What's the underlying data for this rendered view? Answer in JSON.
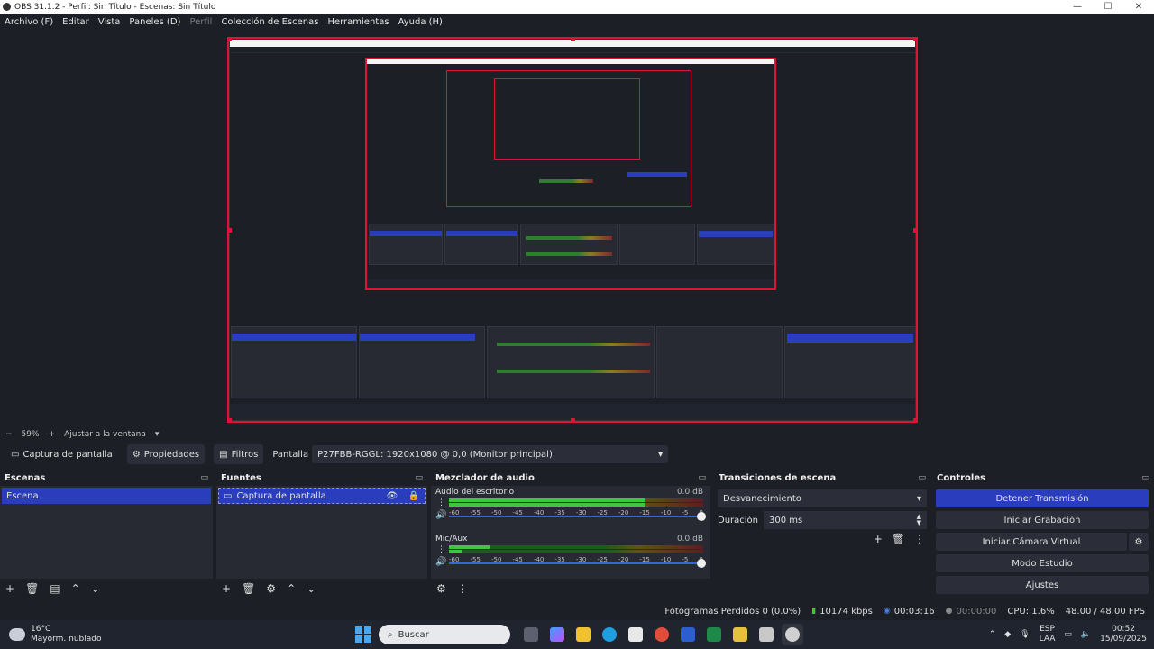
{
  "window": {
    "title": "OBS 31.1.2 - Perfil: Sin Título - Escenas: Sin Título",
    "minimize": "—",
    "maximize": "☐",
    "close": "✕"
  },
  "menu": [
    {
      "label": "Archivo (F)",
      "enabled": true
    },
    {
      "label": "Editar",
      "enabled": true
    },
    {
      "label": "Vista",
      "enabled": true
    },
    {
      "label": "Paneles (D)",
      "enabled": true
    },
    {
      "label": "Perfil",
      "enabled": false
    },
    {
      "label": "Colección de Escenas",
      "enabled": true
    },
    {
      "label": "Herramientas",
      "enabled": true
    },
    {
      "label": "Ayuda (H)",
      "enabled": true
    }
  ],
  "zoom": {
    "minus": "−",
    "value": "59%",
    "plus": "+",
    "fit_label": "Ajustar a la ventana",
    "dropdown": "▾"
  },
  "source_toolbar": {
    "source_name": "Captura de pantalla",
    "properties": "Propiedades",
    "filters": "Filtros",
    "display_label": "Pantalla",
    "display_value": "P27FBB-RGGL: 1920x1080 @ 0,0 (Monitor principal)"
  },
  "scenes": {
    "title": "Escenas",
    "items": [
      "Escena"
    ],
    "selected": 0
  },
  "sources": {
    "title": "Fuentes",
    "items": [
      "Captura de pantalla"
    ]
  },
  "mixer": {
    "title": "Mezclador de audio",
    "channels": [
      {
        "name": "Audio del escritorio",
        "db": "0.0 dB",
        "level": 0.77,
        "level2": 0.77,
        "volume": 1.0
      },
      {
        "name": "Mic/Aux",
        "db": "0.0 dB",
        "level": 0.16,
        "level2": 0.05,
        "volume": 1.0
      }
    ],
    "ticks": [
      "-60",
      "-55",
      "-50",
      "-45",
      "-40",
      "-35",
      "-30",
      "-25",
      "-20",
      "-15",
      "-10",
      "-5",
      "0"
    ]
  },
  "transitions": {
    "title": "Transiciones de escena",
    "selected": "Desvanecimiento",
    "duration_label": "Duración",
    "duration_value": "300 ms"
  },
  "controls": {
    "title": "Controles",
    "buttons": [
      {
        "label": "Detener Transmisión",
        "primary": true
      },
      {
        "label": "Iniciar Grabación",
        "primary": false
      },
      {
        "label": "Iniciar Cámara Virtual",
        "primary": false
      },
      {
        "label": "Modo Estudio",
        "primary": false
      },
      {
        "label": "Ajustes",
        "primary": false
      }
    ]
  },
  "status": {
    "dropped": "Fotogramas Perdidos 0 (0.0%)",
    "bitrate": "10174 kbps",
    "stream_time": "00:03:16",
    "rec_time": "00:00:00",
    "cpu": "CPU: 1.6%",
    "fps": "48.00 / 48.00 FPS"
  },
  "taskbar": {
    "temp": "16°C",
    "weather": "Mayorm. nublado",
    "search_placeholder": "Buscar",
    "lang_top": "ESP",
    "lang_bottom": "LAA",
    "time": "00:52",
    "date": "15/09/2025"
  },
  "colors": {
    "accent": "#2a3dbd",
    "selection": "#e0123a",
    "meter_green": "#3cc73c"
  }
}
